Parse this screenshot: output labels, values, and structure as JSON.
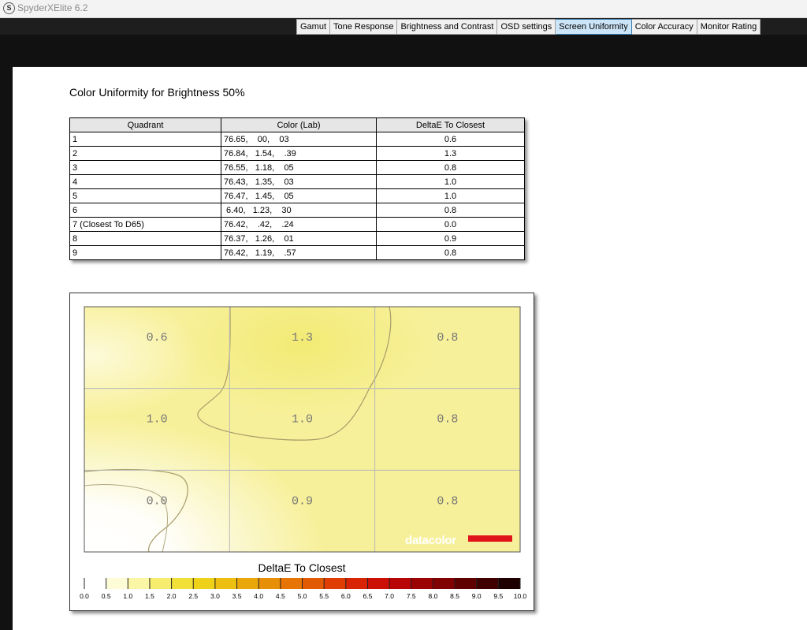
{
  "window": {
    "title": "SpyderXElite 6.2",
    "logo_letter": "S"
  },
  "tabs": [
    {
      "label": "Gamut",
      "active": false
    },
    {
      "label": "Tone Response",
      "active": false
    },
    {
      "label": "Brightness and Contrast",
      "active": false
    },
    {
      "label": "OSD settings",
      "active": false
    },
    {
      "label": "Screen Uniformity",
      "active": true
    },
    {
      "label": "Color Accuracy",
      "active": false
    },
    {
      "label": "Monitor Rating",
      "active": false
    }
  ],
  "report": {
    "heading": "Color Uniformity for Brightness 50%",
    "table": {
      "headers": [
        "Quadrant",
        "Color (Lab)",
        "DeltaE To Closest"
      ],
      "rows": [
        [
          "1",
          "76.65,    00,    03",
          "0.6"
        ],
        [
          "2",
          "76.84,   1.54,    .39",
          "1.3"
        ],
        [
          "3",
          "76.55,   1.18,    05",
          "0.8"
        ],
        [
          "4",
          "76.43,   1.35,    03",
          "1.0"
        ],
        [
          "5",
          "76.47,   1.45,    05",
          "1.0"
        ],
        [
          "6",
          " 6.40,   1.23,    30",
          "0.8"
        ],
        [
          "7 (Closest To D65)",
          "76.42,    .42,    .24",
          "0.0"
        ],
        [
          "8",
          "76.37,   1.26,    01",
          "0.9"
        ],
        [
          "9",
          "76.42,   1.19,    .57",
          "0.8"
        ]
      ]
    }
  },
  "chart_data": {
    "type": "heatmap",
    "grid_rows": 3,
    "grid_cols": 3,
    "values": [
      [
        0.6,
        1.3,
        0.8
      ],
      [
        1.0,
        1.0,
        0.8
      ],
      [
        0.0,
        0.9,
        0.8
      ]
    ],
    "cell_labels": [
      [
        "0.6",
        "1.3",
        "0.8"
      ],
      [
        "1.0",
        "1.0",
        "0.8"
      ],
      [
        "0.0",
        "0.9",
        "0.8"
      ]
    ],
    "scale_title": "DeltaE To Closest",
    "scale_min": 0,
    "scale_max": 10,
    "scale_ticks": [
      "0.0",
      "0.5",
      "1.0",
      "1.5",
      "2.0",
      "2.5",
      "3.0",
      "3.5",
      "4.0",
      "4.5",
      "5.0",
      "5.5",
      "6.0",
      "6.5",
      "7.0",
      "7.5",
      "8.0",
      "8.5",
      "9.0",
      "9.5",
      "10.0"
    ],
    "scale_colors": [
      "#ffffff",
      "#fefcd6",
      "#fbf5a6",
      "#f6ec6e",
      "#f1e038",
      "#eed21a",
      "#ecbf10",
      "#eaa70a",
      "#e88f08",
      "#e67506",
      "#e35a05",
      "#e03d05",
      "#d82405",
      "#cc1005",
      "#b80505",
      "#9c0303",
      "#800202",
      "#600101",
      "#400000",
      "#1e0000"
    ],
    "grid": true,
    "watermark": "datacolor",
    "brand_color": "#e0151b"
  }
}
